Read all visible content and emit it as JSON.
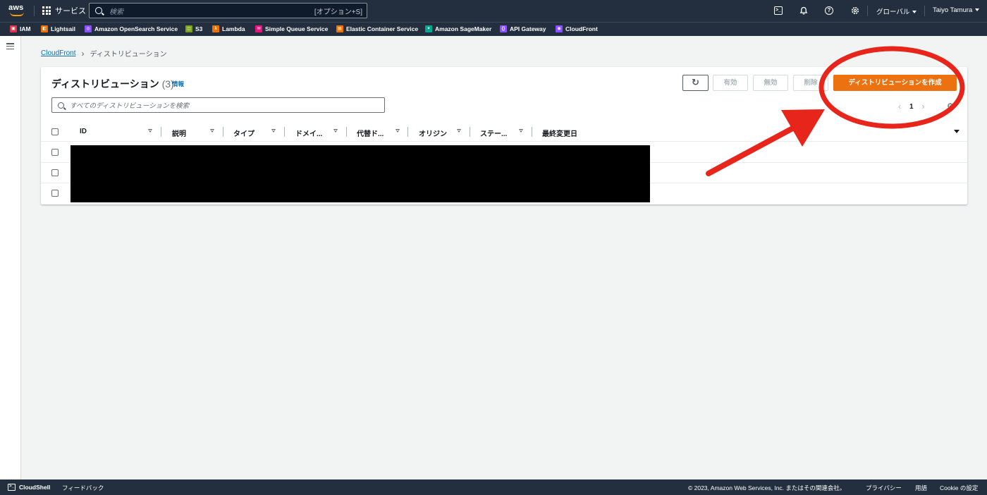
{
  "topnav": {
    "logo": "aws",
    "services_label": "サービス",
    "search_placeholder": "検索",
    "search_shortcut": "[オプション+S]",
    "region": "グローバル",
    "user": "Taiyo Tamura",
    "icons": [
      "cloudshell-icon",
      "bell-icon",
      "help-icon",
      "settings-icon"
    ]
  },
  "favorites": [
    {
      "label": "IAM",
      "color": "#dd344c"
    },
    {
      "label": "Lightsail",
      "color": "#ed7100"
    },
    {
      "label": "Amazon OpenSearch Service",
      "color": "#8c4fff"
    },
    {
      "label": "S3",
      "color": "#7aa116"
    },
    {
      "label": "Lambda",
      "color": "#ed7100"
    },
    {
      "label": "Simple Queue Service",
      "color": "#e7157b"
    },
    {
      "label": "Elastic Container Service",
      "color": "#ed7100"
    },
    {
      "label": "Amazon SageMaker",
      "color": "#01a88d"
    },
    {
      "label": "API Gateway",
      "color": "#8c4fff"
    },
    {
      "label": "CloudFront",
      "color": "#8c4fff"
    }
  ],
  "breadcrumb": {
    "root": "CloudFront",
    "current": "ディストリビューション"
  },
  "panel": {
    "title": "ディストリビューション",
    "count": "(3)",
    "info": "情報",
    "buttons": {
      "enable": "有効",
      "disable": "無効",
      "delete": "削除",
      "create": "ディストリビューションを作成"
    },
    "filter_placeholder": "すべてのディストリビューションを検索",
    "page_number": "1"
  },
  "table": {
    "columns": [
      "ID",
      "説明",
      "タイプ",
      "ドメイ...",
      "代替ド...",
      "オリジン",
      "ステー...",
      "最終変更日"
    ],
    "row_count": 3
  },
  "footer": {
    "cloudshell": "CloudShell",
    "feedback": "フィードバック",
    "copyright": "© 2023, Amazon Web Services, Inc. またはその関連会社。",
    "privacy": "プライバシー",
    "terms": "用語",
    "cookie": "Cookie の設定"
  },
  "colors": {
    "nav_bg": "#232f3e",
    "primary_button": "#ec7211",
    "link": "#0073bb",
    "annotation": "#e8251b"
  }
}
